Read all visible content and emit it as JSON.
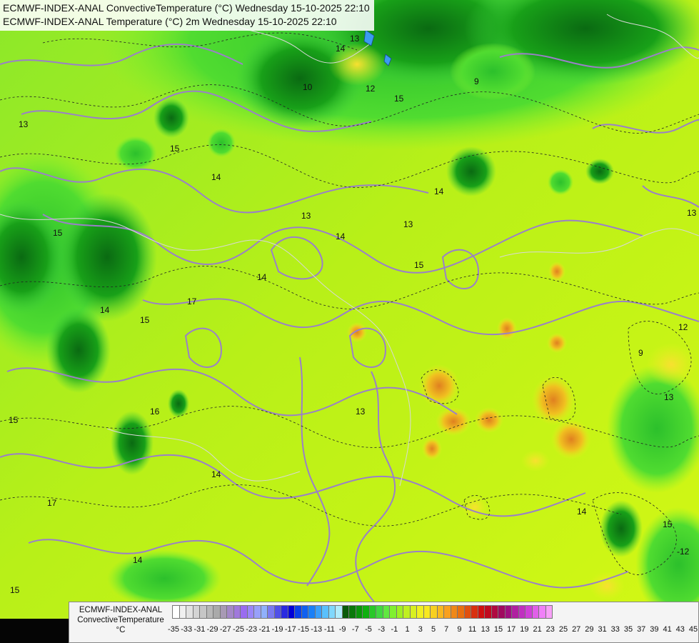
{
  "title_lines": [
    "ECMWF-INDEX-ANAL ConvectiveTemperature (°C) Wednesday 15-10-2025 22:10",
    "ECMWF-INDEX-ANAL Temperature (°C) 2m Wednesday 15-10-2025 22:10"
  ],
  "legend": {
    "title_line1": "ECMWF-INDEX-ANAL",
    "title_line2": "ConvectiveTemperature",
    "unit": "°C",
    "tick_labels": [
      "-35",
      "-33",
      "-31",
      "-29",
      "-27",
      "-25",
      "-23",
      "-21",
      "-19",
      "-17",
      "-15",
      "-13",
      "-11",
      "-9",
      "-7",
      "-5",
      "-3",
      "-1",
      "1",
      "3",
      "5",
      "7",
      "9",
      "11",
      "13",
      "15",
      "17",
      "19",
      "21",
      "23",
      "25",
      "27",
      "29",
      "31",
      "33",
      "35",
      "37",
      "39",
      "41",
      "43",
      "45"
    ],
    "colors": [
      "#ffffff",
      "#f0f0f0",
      "#e2e2e2",
      "#d4d4d4",
      "#c6c6c6",
      "#b8b8b8",
      "#aaaaaa",
      "#a89ab4",
      "#a488c8",
      "#a078dc",
      "#9a6cf0",
      "#9a86f8",
      "#98a0fa",
      "#90b0fc",
      "#7a7af0",
      "#5050e8",
      "#2a2ae0",
      "#0000d8",
      "#0a40e8",
      "#1060f0",
      "#1a80f8",
      "#3aa0fc",
      "#5ac0fc",
      "#80d8fc",
      "#b0ecfc",
      "#0a5a0a",
      "#0a780a",
      "#0a960a",
      "#10b010",
      "#28c828",
      "#40d840",
      "#60e840",
      "#80f030",
      "#a0f020",
      "#c0f020",
      "#d8f020",
      "#f0f020",
      "#f8e820",
      "#f8d020",
      "#f8b820",
      "#f8a020",
      "#f08818",
      "#e87010",
      "#e05010",
      "#d83010",
      "#d01010",
      "#c00a20",
      "#b00a40",
      "#a00a60",
      "#a01080",
      "#b020a0",
      "#c030c0",
      "#d040d8",
      "#e060e8",
      "#f080f8",
      "#f8a0f8"
    ]
  },
  "contour_labels": [
    "13",
    "15",
    "14",
    "13",
    "14",
    "15",
    "14",
    "13",
    "15",
    "16",
    "14",
    "15",
    "17",
    "14",
    "15",
    "12",
    "13",
    "14",
    "15",
    "10",
    "9",
    "12",
    "9",
    "13",
    "13",
    "14",
    "15",
    "-12",
    "13",
    "14",
    "15",
    "17",
    "14"
  ]
}
